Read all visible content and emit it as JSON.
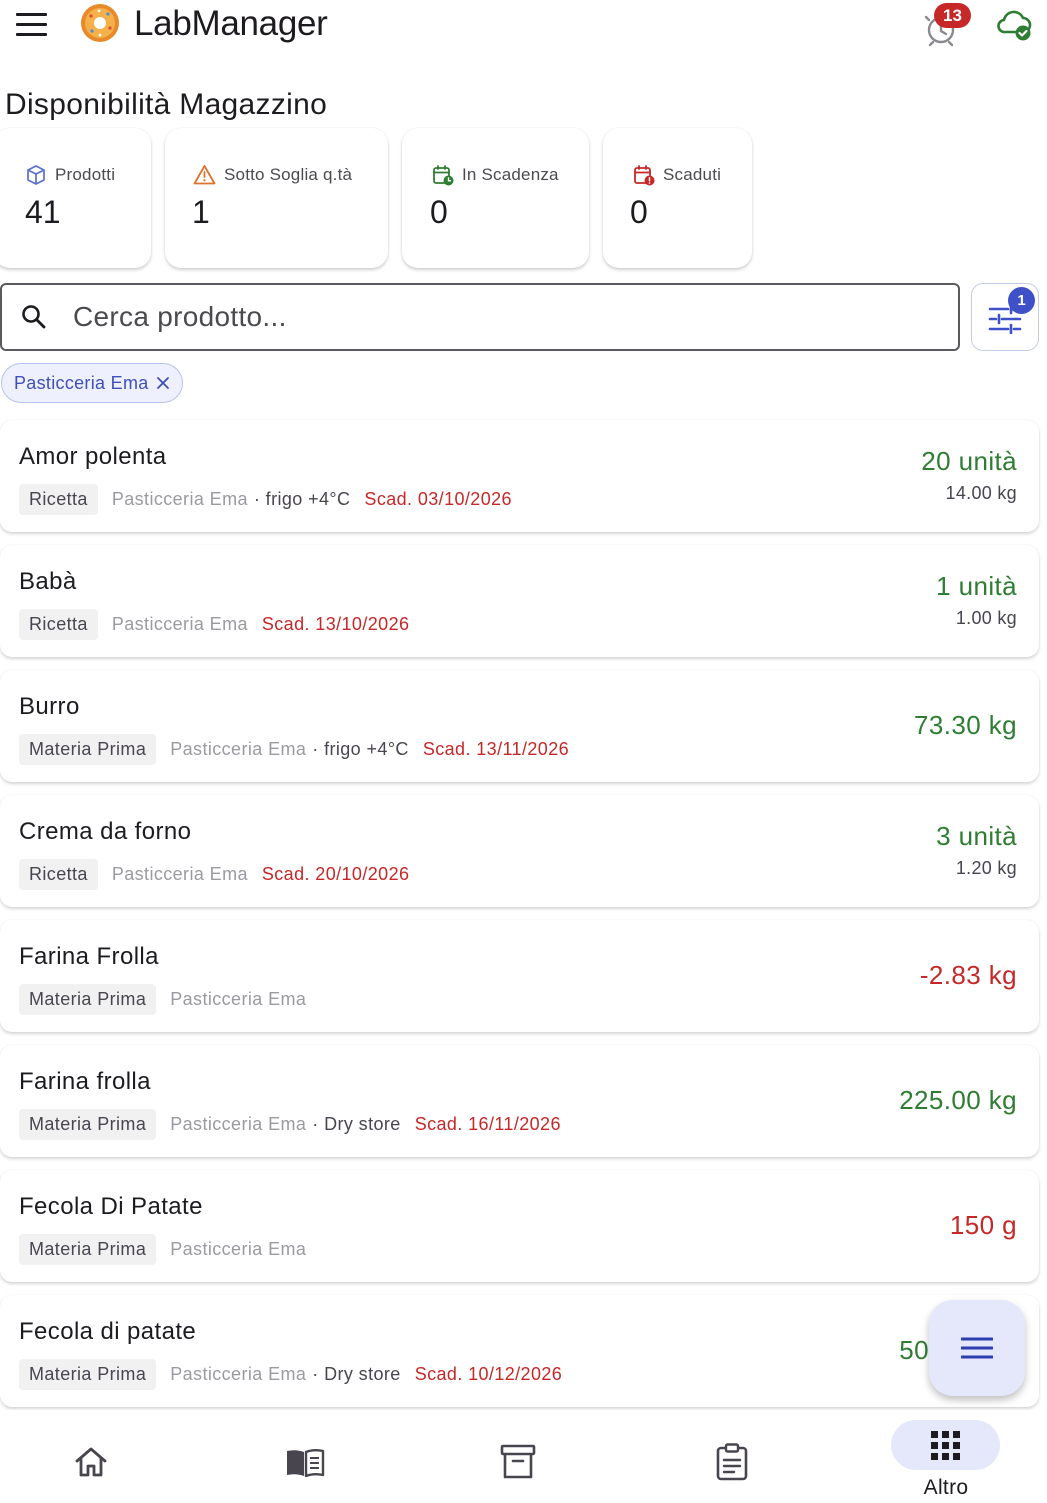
{
  "app": {
    "title": "LabManager",
    "notifications_count": "13",
    "accent_color": "#3f51c8",
    "positive_color": "#2e7d32",
    "negative_color": "#c62828"
  },
  "page": {
    "title": "Disponibilità Magazzino"
  },
  "stats": [
    {
      "label": "Prodotti",
      "value": "41",
      "icon": "box-icon"
    },
    {
      "label": "Sotto Soglia q.tà",
      "value": "1",
      "icon": "warning-icon"
    },
    {
      "label": "In Scadenza",
      "value": "0",
      "icon": "calendar-clock-icon"
    },
    {
      "label": "Scaduti",
      "value": "0",
      "icon": "calendar-alert-icon"
    }
  ],
  "search": {
    "placeholder": "Cerca prodotto...",
    "value": "",
    "filter_count": "1"
  },
  "active_filter": {
    "label": "Pasticceria Ema"
  },
  "products": [
    {
      "name": "Amor polenta",
      "type": "Ricetta",
      "location": "Pasticceria Ema",
      "storage": "· frigo +4°C",
      "expiry": "Scad. 03/10/2026",
      "quantity": "20 unità",
      "weight": "14.00 kg",
      "status": "positive"
    },
    {
      "name": "Babà",
      "type": "Ricetta",
      "location": "Pasticceria Ema",
      "storage": "",
      "expiry": "Scad. 13/10/2026",
      "quantity": "1 unità",
      "weight": "1.00 kg",
      "status": "positive"
    },
    {
      "name": "Burro",
      "type": "Materia Prima",
      "location": "Pasticceria Ema",
      "storage": "· frigo +4°C",
      "expiry": "Scad. 13/11/2026",
      "quantity": "73.30 kg",
      "weight": "",
      "status": "positive"
    },
    {
      "name": "Crema da forno",
      "type": "Ricetta",
      "location": "Pasticceria Ema",
      "storage": "",
      "expiry": "Scad. 20/10/2026",
      "quantity": "3 unità",
      "weight": "1.20 kg",
      "status": "positive"
    },
    {
      "name": "Farina Frolla",
      "type": "Materia Prima",
      "location": "Pasticceria Ema",
      "storage": "",
      "expiry": "",
      "quantity": "-2.83 kg",
      "weight": "",
      "status": "negative"
    },
    {
      "name": "Farina frolla",
      "type": "Materia Prima",
      "location": "Pasticceria Ema",
      "storage": "· Dry store",
      "expiry": "Scad. 16/11/2026",
      "quantity": "225.00 kg",
      "weight": "",
      "status": "positive"
    },
    {
      "name": "Fecola Di Patate",
      "type": "Materia Prima",
      "location": "Pasticceria Ema",
      "storage": "",
      "expiry": "",
      "quantity": "150 g",
      "weight": "",
      "status": "negative"
    },
    {
      "name": "Fecola di patate",
      "type": "Materia Prima",
      "location": "Pasticceria Ema",
      "storage": "· Dry store",
      "expiry": "Scad. 10/12/2026",
      "quantity": "50",
      "weight": "",
      "status": "positive"
    }
  ],
  "bottom_nav": {
    "items": [
      {
        "icon": "home-icon"
      },
      {
        "icon": "book-icon"
      },
      {
        "icon": "archive-icon"
      },
      {
        "icon": "clipboard-icon"
      },
      {
        "icon": "apps-grid-icon",
        "label": "Altro",
        "active": true
      }
    ]
  }
}
